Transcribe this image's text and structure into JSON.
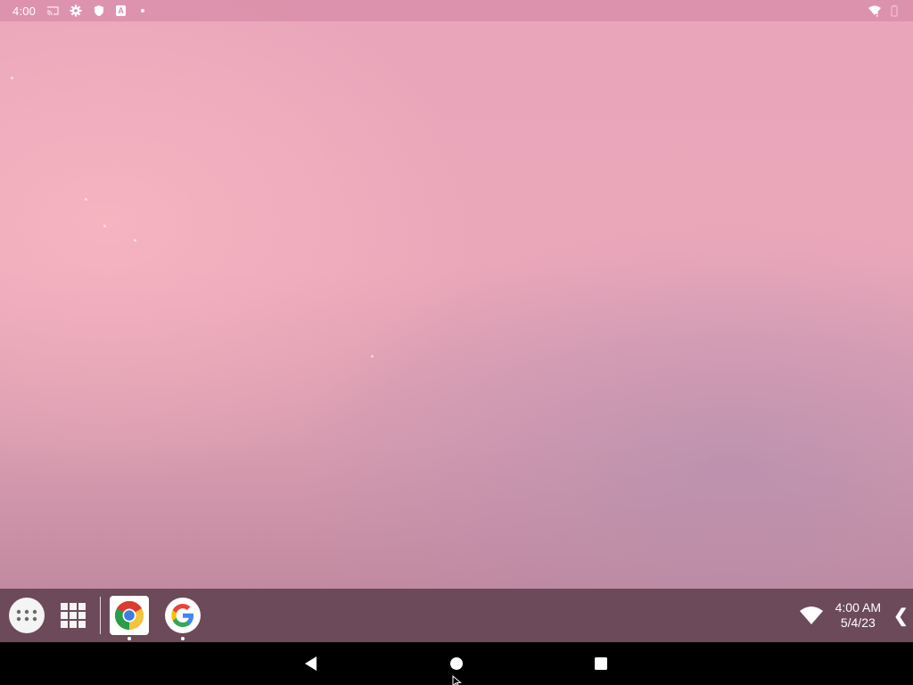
{
  "status_bar": {
    "time": "4:00",
    "left_icons": [
      "cast-icon",
      "gear-icon",
      "shield-icon",
      "a-badge-icon",
      "dot-icon"
    ],
    "a_badge": "A",
    "right_icons": [
      "wifi-icon",
      "battery-icon"
    ]
  },
  "taskbar": {
    "all_apps_icon": "apps-dots-icon",
    "recents_icon": "grid-icon",
    "apps": [
      {
        "name": "Chrome",
        "icon": "chrome-icon",
        "active": true,
        "running": true
      },
      {
        "name": "Google",
        "icon": "google-icon",
        "active": false,
        "running": true
      }
    ],
    "tray": {
      "wifi_icon": "wifi-icon",
      "time": "4:00 AM",
      "date": "5/4/23",
      "chevron": "❮"
    },
    "background": "#6c4a59"
  },
  "nav_bar": {
    "buttons": [
      "back-icon",
      "home-icon",
      "recents-icon"
    ],
    "background": "#000000"
  },
  "wallpaper": {
    "colors": [
      "#e9a6bb",
      "#c28aa0"
    ]
  }
}
